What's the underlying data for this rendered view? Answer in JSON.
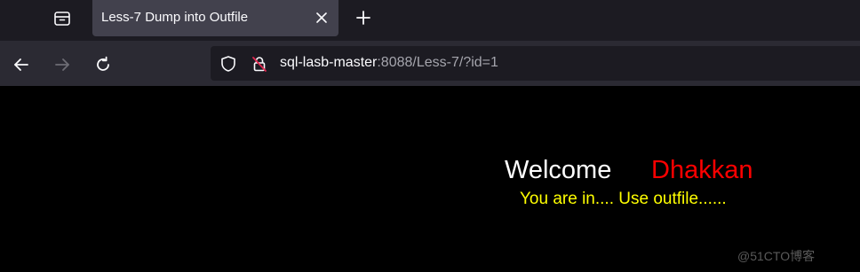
{
  "tab": {
    "title": "Less-7 Dump into Outfile",
    "close_icon": "close-icon"
  },
  "toolbar": {
    "new_tab_icon": "plus-icon",
    "tab_overview_icon": "tab-overview-icon",
    "back_icon": "arrow-left-icon",
    "forward_icon": "arrow-right-icon",
    "reload_icon": "reload-icon"
  },
  "address_bar": {
    "host": "sql-lasb-master",
    "rest": ":8088/Less-7/?id=1",
    "shield_icon": "shield-icon",
    "insecure_lock_icon": "insecure-lock-icon"
  },
  "page": {
    "welcome": "Welcome",
    "name": "Dhakkan",
    "message": "You are in.... Use outfile......"
  },
  "watermark": "@51CTO博客",
  "colors": {
    "background": "#000000",
    "welcome": "#ffffff",
    "name": "#ff0000",
    "message": "#ffff00",
    "tab_active": "#42414d",
    "toolbar": "#2b2a33"
  }
}
